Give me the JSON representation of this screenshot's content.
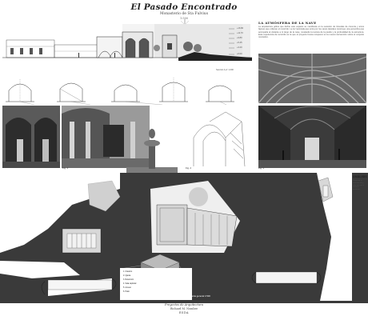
{
  "header": {
    "title": "El Pasado Encontrado",
    "subtitle": "Monasterio de Sta Fulvius",
    "scale": "1:500"
  },
  "text_block": {
    "title": "LA ATMÓSFERA DE LA NAVE",
    "body": "La arquitectura gótica que define este espacio se manifiesta en la sucesión de bóvedas de crucería y arcos fajones que ordenan el recorrido. La luz tamizada que entra por los vanos laterales construye una penumbra que acompaña al visitante a lo largo de la nave, revelando la textura de la piedra y la profundidad de la estructura. Esta experiencia de recorrido es la que el proyecto busca recuperar en la nueva intervención sobre el conjunto monástico."
  },
  "elevation_levels": [
    "+16.80",
    "+11.70",
    "+9.80",
    "+5.45",
    "+3.20",
    "+0.00"
  ],
  "elevation_caption": "Sección A-A' 1:200",
  "figure_labels": [
    "Fig. 1",
    "Fig. 2",
    "Fig. 3"
  ],
  "side_panel": {
    "title": "ANÁLISIS",
    "text": "Planta de la intervención y relación con el claustro existente."
  },
  "plan_caption": "Planta general 1:500",
  "legend": [
    "1. Claustro",
    "2. Iglesia",
    "3. Refectorio",
    "4. Sala capitular",
    "5. Acceso",
    "6. Patio"
  ],
  "footer": {
    "line1": "Proyectos de Arquitectura",
    "line2": "Richard M. Nombre",
    "line3": "ESDA"
  },
  "colors": {
    "band": "#3a3a3a",
    "paper": "#ffffff",
    "plan_fill": "#d8d8d8",
    "stone": "#8a8a8a"
  }
}
